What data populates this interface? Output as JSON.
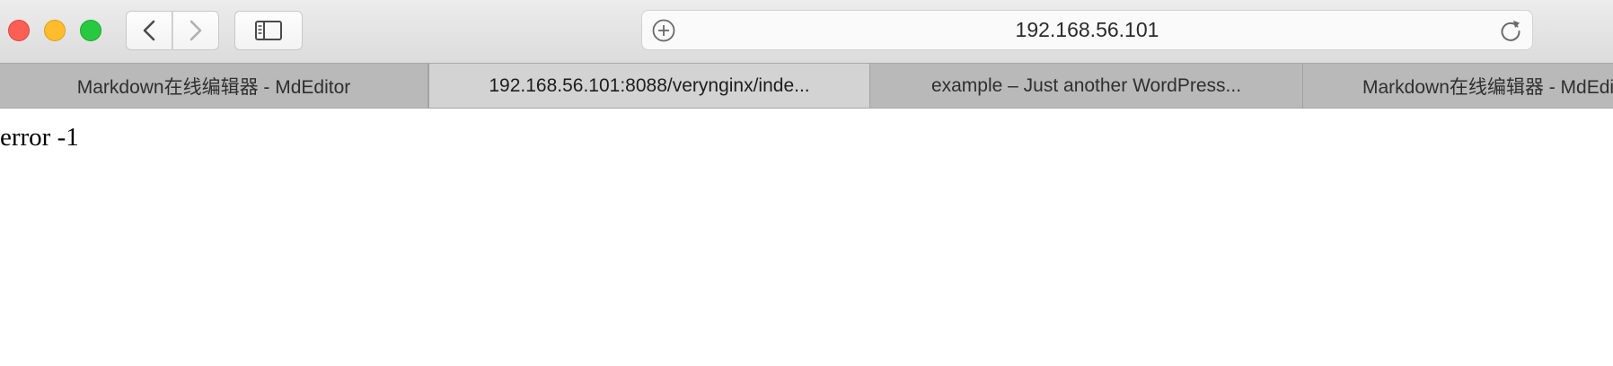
{
  "window": {
    "controls": {
      "close_icon": "close-icon",
      "minimize_icon": "minimize-icon",
      "maximize_icon": "zoom-icon"
    }
  },
  "toolbar": {
    "back_icon": "chevron-left-icon",
    "forward_icon": "chevron-right-icon",
    "sidebar_icon": "sidebar-icon",
    "address": {
      "url": "192.168.56.101",
      "left_icon": "plus-circle-icon",
      "right_icon": "reload-icon"
    }
  },
  "tabs": [
    {
      "title": "Markdown在线编辑器 - MdEditor",
      "active": false
    },
    {
      "title": "192.168.56.101:8088/verynginx/inde...",
      "active": true
    },
    {
      "title": "example – Just another WordPress...",
      "active": false
    },
    {
      "title": "Markdown在线编辑器 - MdEditor",
      "active": false
    }
  ],
  "page": {
    "body_text": "error -1"
  },
  "colors": {
    "close": "#fd5f57",
    "minimize": "#febc2e",
    "maximize": "#28c840",
    "tabbar_bg": "#b9b9b9",
    "active_tab_bg": "#d3d3d3"
  }
}
